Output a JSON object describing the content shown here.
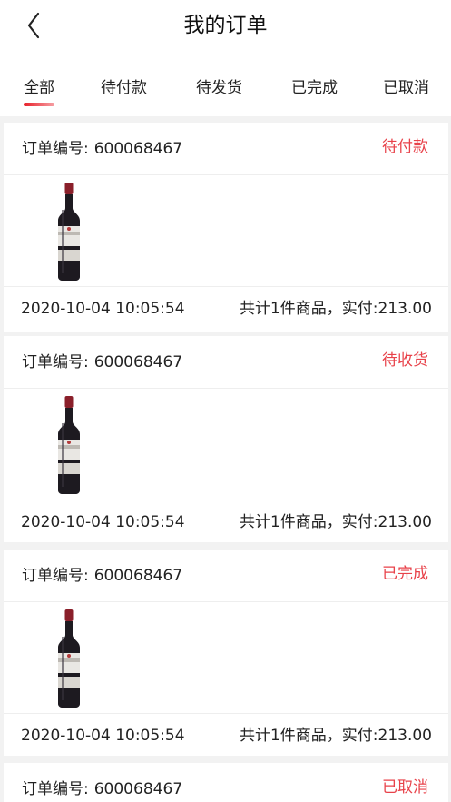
{
  "header": {
    "title": "我的订单",
    "back_icon": "chevron-left-icon"
  },
  "tabs": [
    {
      "label": "全部",
      "active": true
    },
    {
      "label": "待付款",
      "active": false
    },
    {
      "label": "待发货",
      "active": false
    },
    {
      "label": "已完成",
      "active": false
    },
    {
      "label": "已取消",
      "active": false
    }
  ],
  "colors": {
    "accent": "#e8202a",
    "status": "#e8424a",
    "background": "#f2f2f2"
  },
  "order_label": "订单编号:",
  "orders": [
    {
      "order_no": "600068467",
      "status": "待付款",
      "time": "2020-10-04 10:05:54",
      "summary": "共计1件商品，实付:213.00",
      "product_image": "red-wine-bottle"
    },
    {
      "order_no": "600068467",
      "status": "待收货",
      "time": "2020-10-04 10:05:54",
      "summary": "共计1件商品，实付:213.00",
      "product_image": "red-wine-bottle"
    },
    {
      "order_no": "600068467",
      "status": "已完成",
      "time": "2020-10-04 10:05:54",
      "summary": "共计1件商品，实付:213.00",
      "product_image": "red-wine-bottle"
    },
    {
      "order_no": "600068467",
      "status": "已取消"
    }
  ]
}
